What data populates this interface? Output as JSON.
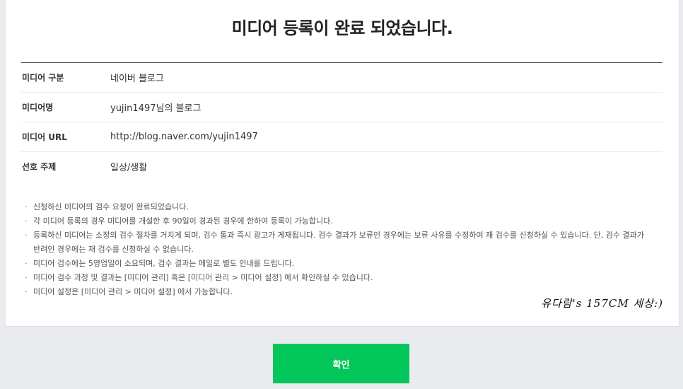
{
  "title": "미디어 등록이 완료 되었습니다.",
  "info": [
    {
      "label": "미디어 구분",
      "value": "네이버 블로그"
    },
    {
      "label": "미디어명",
      "value": "yujin1497님의 블로그"
    },
    {
      "label": "미디어 URL",
      "value": "http://blog.naver.com/yujin1497"
    },
    {
      "label": "선호 주제",
      "value": "일상/생활"
    }
  ],
  "notes": [
    "신청하신 미디어의 검수 요청이 완료되었습니다.",
    "각 미디어 등록의 경우 미디어를 개설한 후 90일이 경과된 경우에 한하여 등록이 가능합니다.",
    "등록하신 미디어는 소정의 검수 절차를 거치게 되며, 검수 통과 즉시 광고가 게재됩니다. 검수 결과가 보류인 경우에는 보류 사유를 수정하여 재 검수를 신청하실 수 있습니다. 단, 검수 결과가 반려인 경우에는 재 검수를 신청하실 수 없습니다.",
    "미디어 검수에는 5영업일이 소요되며, 검수 결과는 메일로 별도 안내를 드립니다.",
    "미디어 검수 과정 및 결과는 [미디어 관리] 혹은 [미디어 관리 > 미디어 설정] 에서 확인하실 수 있습니다.",
    "미디어 설정은 [미디어 관리 > 미디어 설정] 에서 가능합니다."
  ],
  "signature": "유다람's 157CM 세상:)",
  "confirm_label": "확인",
  "colors": {
    "accent": "#03c75a",
    "background": "#e9ebee"
  }
}
